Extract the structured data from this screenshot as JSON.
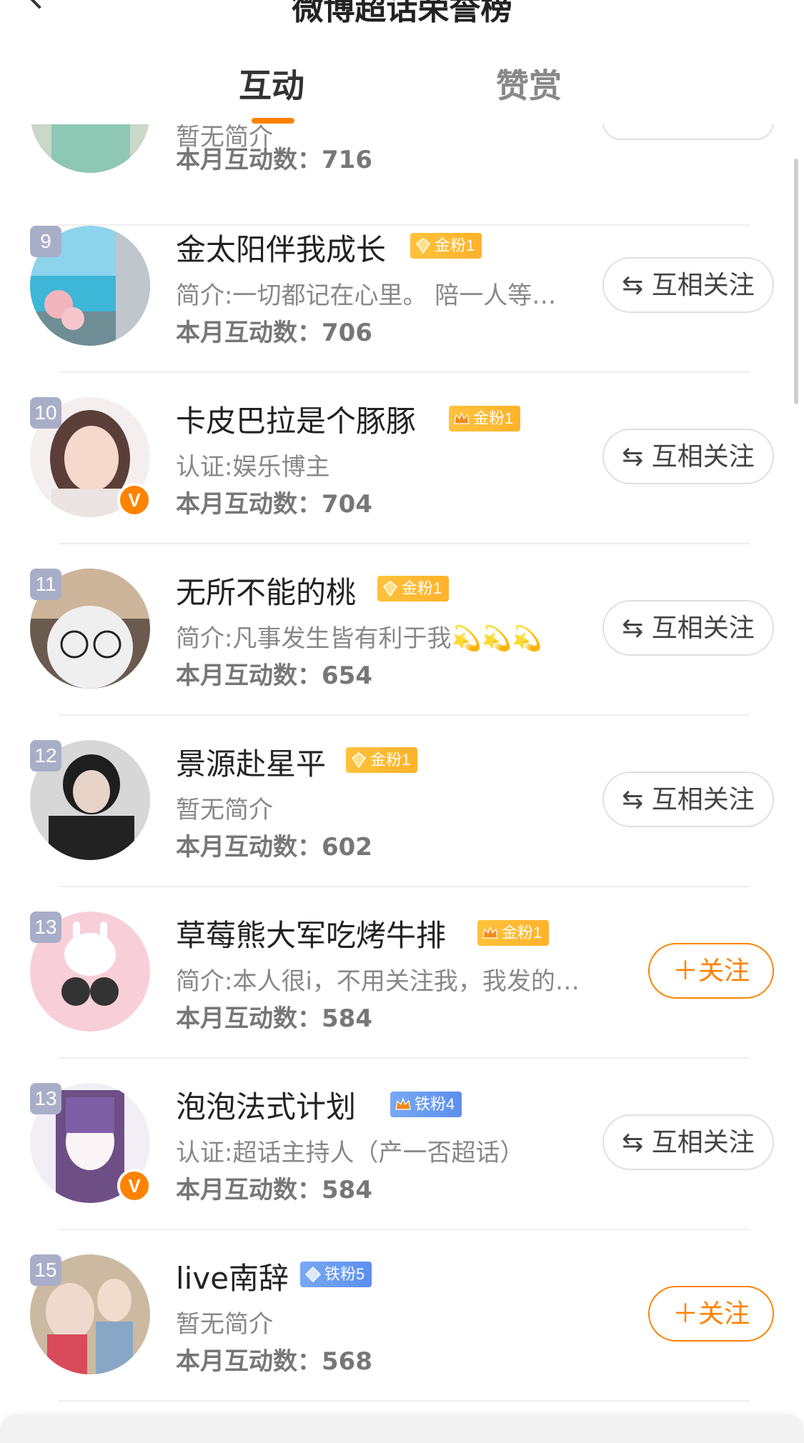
{
  "header": {
    "title": "微博超话荣誉榜"
  },
  "tabs": [
    {
      "label": "互动",
      "active": true
    },
    {
      "label": "赞赏",
      "active": false
    }
  ],
  "colors": {
    "accent": "#ff8200",
    "rank_badge": "#a9aec8",
    "gold_fan": "#ffb22a",
    "iron_fan": "#6f9ff2"
  },
  "partial_row": {
    "bio": "暂无简介",
    "count_label": "本月互动数：",
    "count": "716"
  },
  "users": [
    {
      "rank": "9",
      "name": "金太阳伴我成长",
      "badge": "金粉1",
      "badge_type": "gold",
      "bio": "简介:一切都记在心里。 陪一人等…",
      "count_label": "本月互动数：",
      "count": "706",
      "button": "⇆ 互相关注",
      "button_type": "mutual",
      "verified": false,
      "icon": "gold-fan-icon"
    },
    {
      "rank": "10",
      "name": "卡皮巴拉是个豚豚",
      "badge": "金粉1",
      "badge_type": "gold",
      "bio": "认证:娱乐博主",
      "count_label": "本月互动数：",
      "count": "704",
      "button": "⇆ 互相关注",
      "button_type": "mutual",
      "verified": true,
      "icon": "crown-icon"
    },
    {
      "rank": "11",
      "name": "无所不能的桃",
      "badge": "金粉1",
      "badge_type": "gold",
      "bio": "简介:凡事发生皆有利于我💫💫💫",
      "count_label": "本月互动数：",
      "count": "654",
      "button": "⇆ 互相关注",
      "button_type": "mutual",
      "verified": false,
      "icon": "gold-fan-icon"
    },
    {
      "rank": "12",
      "name": "景源赴星平",
      "badge": "金粉1",
      "badge_type": "gold",
      "bio": "暂无简介",
      "count_label": "本月互动数：",
      "count": "602",
      "button": "⇆ 互相关注",
      "button_type": "mutual",
      "verified": false,
      "icon": "gold-fan-icon"
    },
    {
      "rank": "13",
      "name": "草莓熊大军吃烤牛排",
      "badge": "金粉1",
      "badge_type": "gold",
      "bio": "简介:本人很i，不用关注我，我发的…",
      "count_label": "本月互动数：",
      "count": "584",
      "button": "＋关注",
      "button_type": "follow",
      "verified": false,
      "icon": "crown-icon"
    },
    {
      "rank": "13",
      "name": "泡泡法式计划",
      "badge": "铁粉4",
      "badge_type": "iron",
      "bio": "认证:超话主持人（产一否超话）",
      "count_label": "本月互动数：",
      "count": "584",
      "button": "⇆ 互相关注",
      "button_type": "mutual",
      "verified": true,
      "icon": "crown-icon"
    },
    {
      "rank": "15",
      "name": "live南辞",
      "badge": "铁粉5",
      "badge_type": "iron",
      "bio": "暂无简介",
      "count_label": "本月互动数：",
      "count": "568",
      "button": "＋关注",
      "button_type": "follow",
      "verified": false,
      "icon": "diamond-icon"
    }
  ]
}
